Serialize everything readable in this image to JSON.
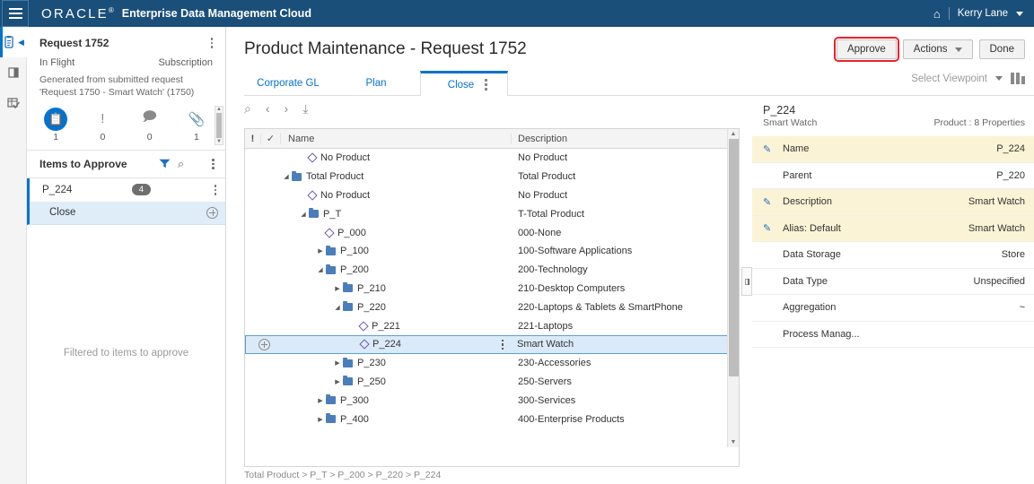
{
  "header": {
    "menu_icon": "hamburger-icon",
    "brand": "ORACLE",
    "brand_mark": "®",
    "app_name": "Enterprise Data Management Cloud",
    "home_icon": "home-icon",
    "user": "Kerry Lane"
  },
  "rail": {
    "items": [
      {
        "name": "requests-icon",
        "glyph": "clipboard"
      },
      {
        "name": "panel-split-icon",
        "glyph": "split"
      },
      {
        "name": "validate-grid-icon",
        "glyph": "grid-check"
      }
    ]
  },
  "request_panel": {
    "title": "Request 1752",
    "status": "In Flight",
    "type": "Subscription",
    "description": "Generated from submitted request 'Request 1750 - Smart Watch' (1750)",
    "tabs": [
      {
        "name": "request-items-tab",
        "icon": "clipboard-icon",
        "count": "1",
        "selected": true
      },
      {
        "name": "request-issues-tab",
        "icon": "exclamation-icon",
        "count": "0",
        "selected": false
      },
      {
        "name": "request-comments-tab",
        "icon": "comment-icon",
        "count": "0",
        "selected": false
      },
      {
        "name": "request-attachments-tab",
        "icon": "paperclip-icon",
        "count": "1",
        "selected": false
      }
    ],
    "items_header": {
      "title": "Items to Approve",
      "filter_icon": "filter-icon",
      "search_icon": "search-icon",
      "menu_icon": "kebab-menu-icon"
    },
    "items": [
      {
        "label": "P_224",
        "badge": "4"
      },
      {
        "label": "Close",
        "action_icon": "add-circle-icon"
      }
    ],
    "footer_note": "Filtered to items to approve"
  },
  "main": {
    "page_title": "Product Maintenance - Request 1752",
    "actions": {
      "approve": "Approve",
      "actions": "Actions",
      "done": "Done"
    },
    "viewpoint_tabs": [
      {
        "label": "Corporate GL",
        "active": false
      },
      {
        "label": "Plan",
        "active": false
      },
      {
        "label": "Close",
        "active": true
      }
    ],
    "viewpoint_select": {
      "label": "Select Viewpoint",
      "grid_icon": "layout-columns-icon"
    },
    "tree_toolbar": [
      {
        "name": "search-icon",
        "glyph": "⌕"
      },
      {
        "name": "previous-icon",
        "glyph": "‹"
      },
      {
        "name": "next-icon",
        "glyph": "›"
      },
      {
        "name": "export-icon",
        "glyph": "⤓"
      }
    ],
    "tree_columns": {
      "flag": "!",
      "check": "✓",
      "name": "Name",
      "description": "Description"
    },
    "tree_rows": [
      {
        "indent": 1,
        "twisty": "",
        "icon": "diamond",
        "name": "No Product",
        "description": "No Product",
        "selected": false
      },
      {
        "indent": 0,
        "twisty": "open",
        "icon": "folder",
        "name": "Total Product",
        "description": "Total Product",
        "selected": false
      },
      {
        "indent": 1,
        "twisty": "",
        "icon": "diamond",
        "name": "No Product",
        "description": "No Product",
        "selected": false
      },
      {
        "indent": 1,
        "twisty": "open",
        "icon": "folder",
        "name": "P_T",
        "description": "T-Total Product",
        "selected": false
      },
      {
        "indent": 2,
        "twisty": "",
        "icon": "diamond",
        "name": "P_000",
        "description": "000-None",
        "selected": false
      },
      {
        "indent": 2,
        "twisty": "closed",
        "icon": "folder",
        "name": "P_100",
        "description": "100-Software Applications",
        "selected": false
      },
      {
        "indent": 2,
        "twisty": "open",
        "icon": "folder",
        "name": "P_200",
        "description": "200-Technology",
        "selected": false
      },
      {
        "indent": 3,
        "twisty": "closed",
        "icon": "folder",
        "name": "P_210",
        "description": "210-Desktop Computers",
        "selected": false
      },
      {
        "indent": 3,
        "twisty": "open",
        "icon": "folder",
        "name": "P_220",
        "description": "220-Laptops & Tablets & SmartPhone",
        "selected": false
      },
      {
        "indent": 4,
        "twisty": "",
        "icon": "diamond",
        "name": "P_221",
        "description": "221-Laptops",
        "selected": false
      },
      {
        "indent": 4,
        "twisty": "",
        "icon": "diamond",
        "name": "P_224",
        "description": "Smart Watch",
        "selected": true
      },
      {
        "indent": 3,
        "twisty": "closed",
        "icon": "folder",
        "name": "P_230",
        "description": "230-Accessories",
        "selected": false
      },
      {
        "indent": 3,
        "twisty": "closed",
        "icon": "folder",
        "name": "P_250",
        "description": "250-Servers",
        "selected": false
      },
      {
        "indent": 2,
        "twisty": "closed",
        "icon": "folder",
        "name": "P_300",
        "description": "300-Services",
        "selected": false
      },
      {
        "indent": 2,
        "twisty": "closed",
        "icon": "folder",
        "name": "P_400",
        "description": "400-Enterprise Products",
        "selected": false
      }
    ],
    "breadcrumb": "Total Product > P_T > P_200 > P_220 > P_224"
  },
  "properties": {
    "node_name": "P_224",
    "node_description": "Smart Watch",
    "meta": "Product : 8 Properties",
    "rows": [
      {
        "label": "Name",
        "value": "P_224",
        "editable": true
      },
      {
        "label": "Parent",
        "value": "P_220",
        "editable": false
      },
      {
        "label": "Description",
        "value": "Smart Watch",
        "editable": true
      },
      {
        "label": "Alias: Default",
        "value": "Smart Watch",
        "editable": true
      },
      {
        "label": "Data Storage",
        "value": "Store",
        "editable": false
      },
      {
        "label": "Data Type",
        "value": "Unspecified",
        "editable": false
      },
      {
        "label": "Aggregation",
        "value": "~",
        "editable": false
      },
      {
        "label": "Process Manag...",
        "value": "",
        "editable": false
      }
    ]
  },
  "colors": {
    "header_blue": "#1a4f7a",
    "accent_blue": "#0572ce",
    "highlight_red": "#e8232a",
    "editable_yellow": "#fbf3d5",
    "selection_blue": "#dbeaf8"
  }
}
